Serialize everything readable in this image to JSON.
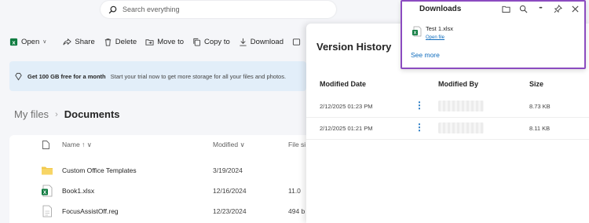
{
  "search": {
    "placeholder": "Search everything"
  },
  "toolbar": {
    "open": "Open",
    "share": "Share",
    "delete": "Delete",
    "move_to": "Move to",
    "copy_to": "Copy to",
    "download": "Download"
  },
  "promo": {
    "title": "Get 100 GB free for a month",
    "text": "Start your trial now to get more storage for all your files and photos."
  },
  "breadcrumb": {
    "root": "My files",
    "current": "Documents"
  },
  "file_list": {
    "columns": {
      "name": "Name ↑ ∨",
      "modified": "Modified ∨",
      "size": "File si"
    },
    "rows": [
      {
        "name": "Custom Office Templates",
        "modified": "3/19/2024",
        "size": "",
        "icon": "folder-icon"
      },
      {
        "name": "Book1.xlsx",
        "modified": "12/16/2024",
        "size": "11.0",
        "icon": "excel-file-icon"
      },
      {
        "name": "FocusAssistOff.reg",
        "modified": "12/23/2024",
        "size": "494 b",
        "icon": "reg-file-icon"
      }
    ]
  },
  "version_history": {
    "title": "Version History",
    "columns": {
      "date": "Modified Date",
      "by": "Modified By",
      "size": "Size"
    },
    "rows": [
      {
        "date": "2/12/2025 01:23 PM",
        "size": "8.73 KB"
      },
      {
        "date": "2/12/2025 01:21 PM",
        "size": "8.11 KB"
      }
    ]
  },
  "downloads": {
    "title": "Downloads",
    "file_name": "Test 1.xlsx",
    "open_file": "Open file",
    "see_more": "See more",
    "more_glyph": "•••",
    "border_color": "#8b4bc0"
  },
  "colors": {
    "accent": "#0f6cbd",
    "excel": "#107c41",
    "folder": "#f2c94c"
  }
}
